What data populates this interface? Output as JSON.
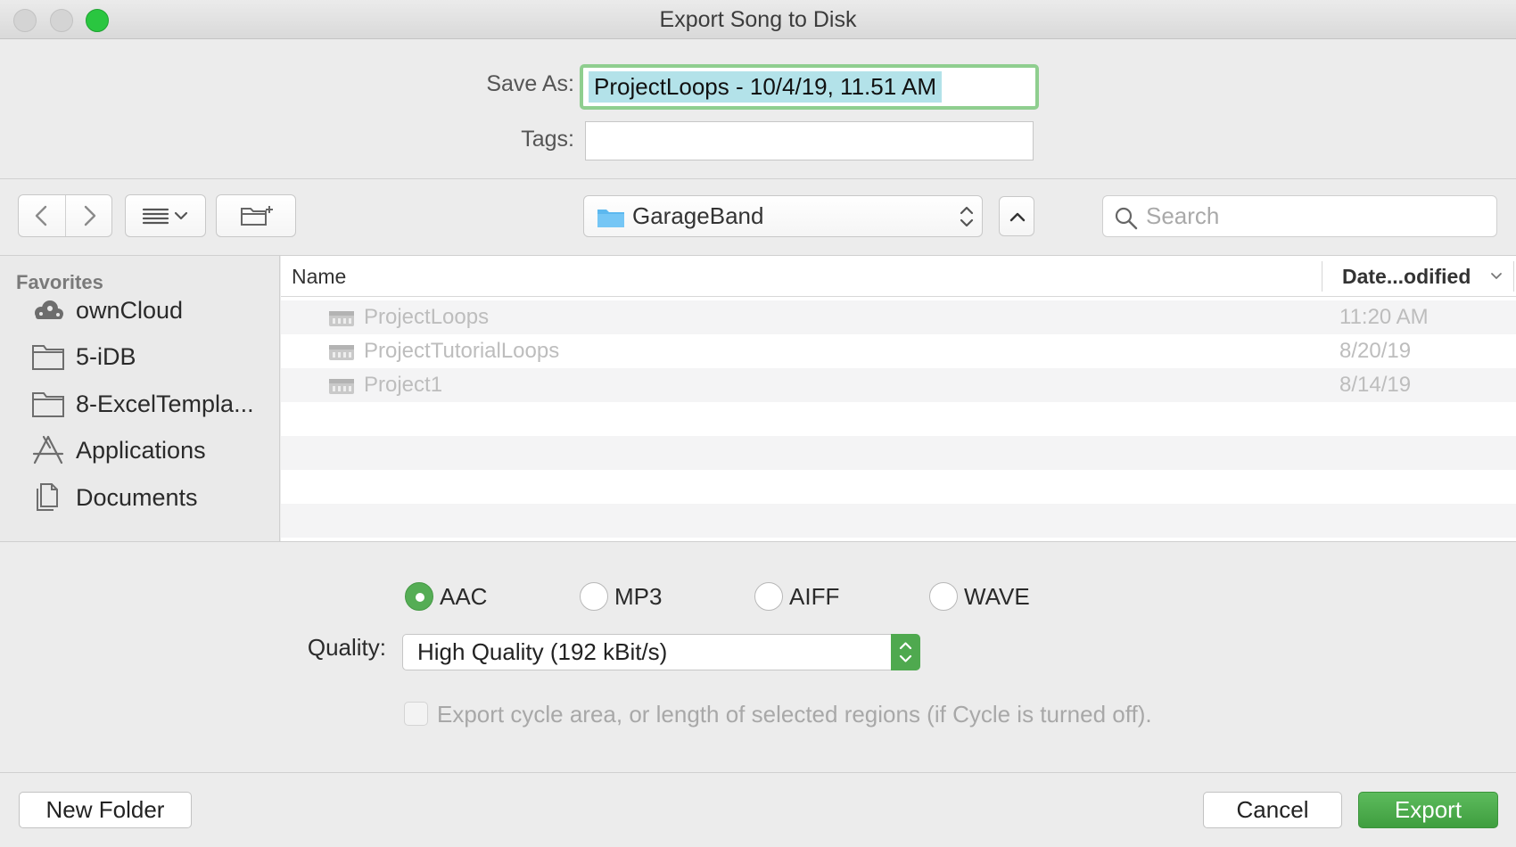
{
  "window": {
    "title": "Export Song to Disk"
  },
  "save": {
    "save_as_label": "Save As:",
    "save_as_value": "ProjectLoops - 10/4/19, 11.51 AM",
    "tags_label": "Tags:",
    "tags_value": ""
  },
  "toolbar": {
    "location": "GarageBand",
    "search_placeholder": "Search"
  },
  "sidebar": {
    "heading": "Favorites",
    "items": [
      {
        "label": "ownCloud",
        "icon": "cloud-icon"
      },
      {
        "label": "5-iDB",
        "icon": "folder-icon"
      },
      {
        "label": "8-ExcelTempla...",
        "icon": "folder-icon"
      },
      {
        "label": "Applications",
        "icon": "applications-icon"
      },
      {
        "label": "Documents",
        "icon": "documents-icon"
      }
    ]
  },
  "filelist": {
    "columns": {
      "name": "Name",
      "date": "Date...odified"
    },
    "rows": [
      {
        "name": "ProjectLoops",
        "date": "11:20 AM"
      },
      {
        "name": "ProjectTutorialLoops",
        "date": "8/20/19"
      },
      {
        "name": "Project1",
        "date": "8/14/19"
      }
    ]
  },
  "format": {
    "options": [
      {
        "label": "AAC",
        "selected": true
      },
      {
        "label": "MP3",
        "selected": false
      },
      {
        "label": "AIFF",
        "selected": false
      },
      {
        "label": "WAVE",
        "selected": false
      }
    ],
    "quality_label": "Quality:",
    "quality_value": "High Quality (192 kBit/s)",
    "cycle_label": "Export cycle area, or length of selected regions (if Cycle is turned off).",
    "cycle_checked": false
  },
  "buttons": {
    "new_folder": "New Folder",
    "cancel": "Cancel",
    "export": "Export"
  },
  "colors": {
    "accent_green": "#55ad55",
    "selection_highlight": "#b3e2e9",
    "focus_ring": "#8fce8f"
  }
}
